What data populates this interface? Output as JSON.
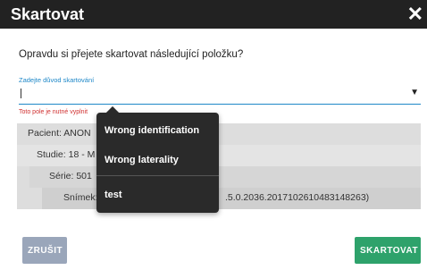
{
  "dialog": {
    "title": "Skartovat",
    "close_icon": "close-icon",
    "question": "Opravdu si přejete skartovat následující položku?",
    "reason_field": {
      "label": "Zadejte důvod skartování",
      "value": "",
      "error": "Toto pole je nutné vyplnit",
      "dropdown_icon": "chevron-down-icon"
    },
    "tree": {
      "patient": "Pacient: ANON",
      "study": "Studie: 18 - M",
      "series": "Série: 501",
      "image_prefix": "Snímek:",
      "image_suffix": ".5.0.2036.20171026104831482​63)"
    },
    "buttons": {
      "cancel": "ZRUŠIT",
      "confirm": "SKARTOVAT"
    }
  },
  "reason_menu": {
    "items": [
      "Wrong identification",
      "Wrong laterality",
      "test"
    ]
  },
  "colors": {
    "accent": "#1f88c8",
    "error": "#d03030",
    "confirm": "#2ea26b",
    "cancel": "#9aa6ba",
    "titlebar": "#222222"
  }
}
